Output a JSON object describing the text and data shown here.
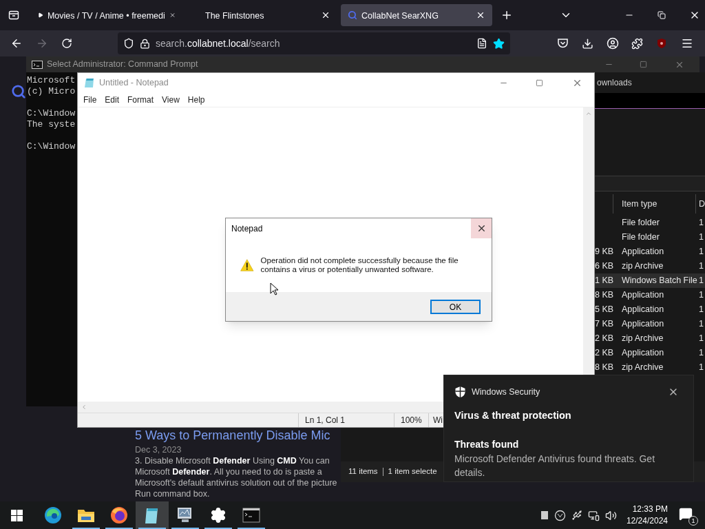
{
  "browser": {
    "tabs": [
      {
        "title": "Movies / TV / Anime • freemedi",
        "kind": "media",
        "selected": false
      },
      {
        "title": "The Flintstones",
        "kind": "plain",
        "selected": false
      },
      {
        "title": "CollabNet SearXNG",
        "kind": "search",
        "selected": true
      }
    ],
    "url": {
      "scheme": "search.",
      "host": "collabnet.local",
      "path": "/search"
    },
    "bookmarked": true
  },
  "search_page": {
    "result": {
      "title": "5 Ways to Permanently Disable Mic",
      "date": "Dec 3, 2023",
      "snippet": [
        "3. Disable Microsoft **Defender** Using **CMD** You can",
        "Microsoft **Defender**. All you need to do is paste a",
        "Microsoft's default antivirus solution out of the picture",
        "Run command box."
      ]
    }
  },
  "cmd": {
    "title": "Select Administrator: Command Prompt",
    "blocks": [
      [
        "Microsoft",
        "(c) Micro"
      ],
      [
        "C:\\Window",
        "The syste"
      ],
      [
        "C:\\Window"
      ]
    ]
  },
  "explorer": {
    "address": "ownloads",
    "columns": [
      "Item type",
      "D"
    ],
    "rows": [
      {
        "type": "File folder",
        "column_3": "1",
        "selected": false
      },
      {
        "type": "File folder",
        "column_3": "1",
        "selected": false
      },
      {
        "size": "9 KB",
        "type": "Application",
        "column_3": "1",
        "selected": false
      },
      {
        "size": "6 KB",
        "type": "zip Archive",
        "column_3": "1",
        "selected": false
      },
      {
        "size": "1 KB",
        "type": "Windows Batch File",
        "column_3": "1",
        "selected": true
      },
      {
        "size": "8 KB",
        "type": "Application",
        "column_3": "1",
        "selected": false
      },
      {
        "size": "5 KB",
        "type": "Application",
        "column_3": "1",
        "selected": false
      },
      {
        "size": "7 KB",
        "type": "Application",
        "column_3": "1",
        "selected": false
      },
      {
        "size": "2 KB",
        "type": "zip Archive",
        "column_3": "1",
        "selected": false
      },
      {
        "size": "2 KB",
        "type": "Application",
        "column_3": "1",
        "selected": false
      },
      {
        "size": "8 KB",
        "type": "zip Archive",
        "column_3": "1",
        "selected": false
      }
    ],
    "status": [
      "11 items",
      "1 item selecte"
    ]
  },
  "notepad": {
    "title": "Untitled - Notepad",
    "menu": [
      "File",
      "Edit",
      "Format",
      "View",
      "Help"
    ],
    "status": [
      "Ln 1, Col 1",
      "100%",
      "Wi"
    ]
  },
  "dialog": {
    "title": "Notepad",
    "message": "Operation did not complete successfully because the file contains a virus or potentially unwanted software.",
    "button": "OK"
  },
  "toast": {
    "app": "Windows Security",
    "heading": "Virus & threat protection",
    "title": "Threats found",
    "body": "Microsoft Defender Antivirus found threats. Get details."
  },
  "taskbar": {
    "apps": [
      {
        "kind": "edge",
        "running": false,
        "active": false
      },
      {
        "kind": "folder",
        "running": true,
        "active": false
      },
      {
        "kind": "firefox",
        "running": true,
        "active": false
      },
      {
        "kind": "notepad",
        "running": true,
        "active": true
      },
      {
        "kind": "monitor",
        "running": true,
        "active": false
      },
      {
        "kind": "gear",
        "running": true,
        "active": false
      },
      {
        "kind": "terminal",
        "running": true,
        "active": false
      }
    ],
    "time": "12:33 PM",
    "date": "12/24/2024",
    "notifications": "1"
  }
}
